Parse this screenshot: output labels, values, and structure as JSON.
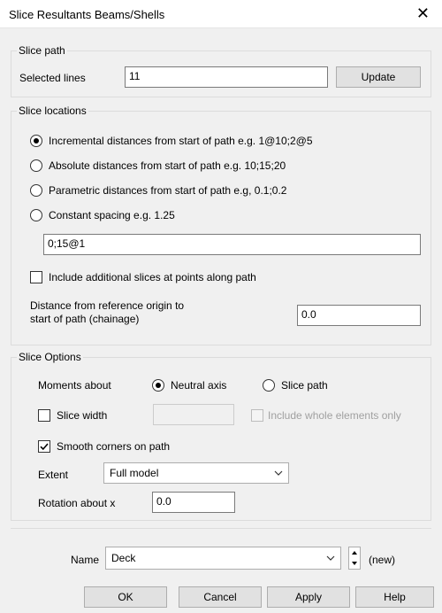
{
  "window": {
    "title": "Slice Resultants Beams/Shells",
    "close_glyph": "✕"
  },
  "slice_path": {
    "legend": "Slice path",
    "selected_lines_label": "Selected lines",
    "selected_lines_value": "11",
    "update_button": "Update"
  },
  "slice_locations": {
    "legend": "Slice locations",
    "options": [
      {
        "label": "Incremental distances from start of path e.g. 1@10;2@5",
        "selected": true
      },
      {
        "label": "Absolute distances from start of path e.g. 10;15;20",
        "selected": false
      },
      {
        "label": "Parametric distances from start of path e.g, 0.1;0.2",
        "selected": false
      },
      {
        "label": "Constant spacing e.g. 1.25",
        "selected": false
      }
    ],
    "locations_value": "0;15@1",
    "include_additional_label": "Include additional slices at points along path",
    "include_additional_checked": false,
    "distance_label_line1": "Distance from reference origin to",
    "distance_label_line2": "start of path (chainage)",
    "distance_value": "0.0"
  },
  "slice_options": {
    "legend": "Slice Options",
    "moments_label": "Moments about",
    "neutral_axis_label": "Neutral axis",
    "neutral_axis_selected": true,
    "slice_path_label": "Slice path",
    "slice_path_selected": false,
    "slice_width_label": "Slice width",
    "slice_width_checked": false,
    "slice_width_value": "",
    "include_whole_label": "Include whole elements only",
    "smooth_corners_label": "Smooth corners on path",
    "smooth_corners_checked": true,
    "extent_label": "Extent",
    "extent_value": "Full model",
    "rotation_label": "Rotation about x",
    "rotation_value": "0.0"
  },
  "name_row": {
    "label": "Name",
    "value": "Deck",
    "status": "(new)"
  },
  "buttons": {
    "ok": "OK",
    "cancel": "Cancel",
    "apply": "Apply",
    "help": "Help"
  },
  "icons": {
    "check": "check-mark",
    "chevron": "chevron-down-icon",
    "spin_up": "caret-up-icon",
    "spin_down": "caret-down-icon"
  }
}
